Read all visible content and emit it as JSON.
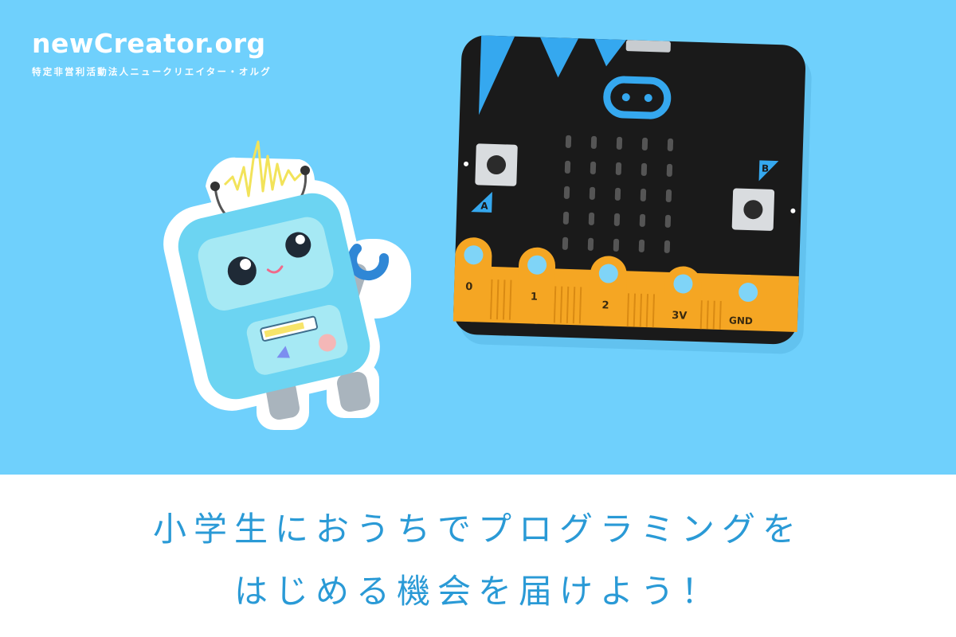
{
  "brand": {
    "name": "newCreator.org",
    "subtitle": "特定非営利活動法人ニュークリエイター・オルグ"
  },
  "board": {
    "button_a_label": "A",
    "button_b_label": "B",
    "pins": [
      "0",
      "1",
      "2",
      "3V",
      "GND"
    ]
  },
  "tagline": {
    "line1": "小学生におうちでプログラミングを",
    "line2": "はじめる機会を届けよう！"
  },
  "colors": {
    "hero_background": "#6fd0fc",
    "tagline_text": "#2a9ad6",
    "board_black": "#1a1a1a",
    "board_accent": "#35a8ef",
    "pin_gold": "#f5a623"
  }
}
